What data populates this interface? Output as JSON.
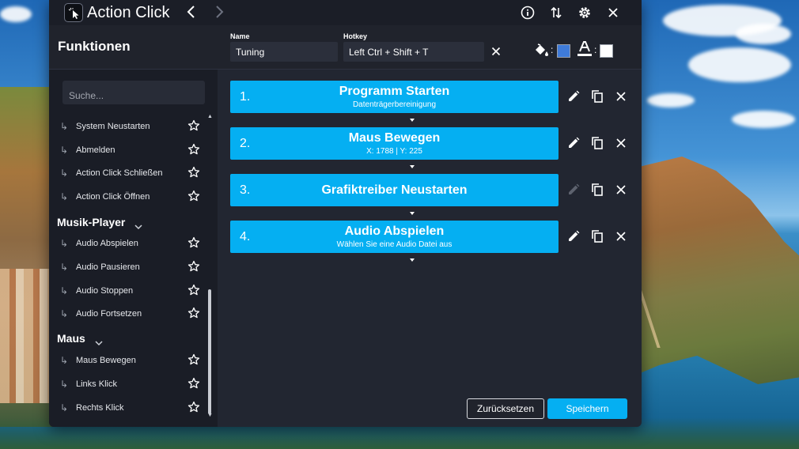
{
  "window": {
    "title": "Action Click",
    "icons": [
      "app-cursor-icon",
      "back-icon",
      "forward-icon",
      "info-icon",
      "sort-icon",
      "gear-icon",
      "close-icon"
    ]
  },
  "sidebar": {
    "title": "Funktionen",
    "search_placeholder": "Suche...",
    "items": [
      {
        "label": "System Neustarten"
      },
      {
        "label": "Abmelden"
      },
      {
        "label": "Action Click Schließen"
      },
      {
        "label": "Action Click Öffnen"
      }
    ],
    "categories": [
      {
        "label": "Musik-Player",
        "items": [
          {
            "label": "Audio Abspielen"
          },
          {
            "label": "Audio Pausieren"
          },
          {
            "label": "Audio Stoppen"
          },
          {
            "label": "Audio Fortsetzen"
          }
        ]
      },
      {
        "label": "Maus",
        "items": [
          {
            "label": "Maus Bewegen"
          },
          {
            "label": "Links Klick"
          },
          {
            "label": "Rechts Klick"
          }
        ]
      }
    ]
  },
  "form": {
    "name_label": "Name",
    "name_value": "Tuning",
    "hotkey_label": "Hotkey",
    "hotkey_value": "Left Ctrl + Shift + T",
    "colon": ":",
    "background_color": "#3f7bd9",
    "text_color": "#ffffff"
  },
  "steps": [
    {
      "num": "1.",
      "title": "Programm Starten",
      "subtitle": "Datenträgerbereinigung",
      "edit_enabled": true
    },
    {
      "num": "2.",
      "title": "Maus Bewegen",
      "subtitle": "X: 1788 | Y: 225",
      "edit_enabled": true
    },
    {
      "num": "3.",
      "title": "Grafiktreiber Neustarten",
      "subtitle": "",
      "edit_enabled": false
    },
    {
      "num": "4.",
      "title": "Audio Abspielen",
      "subtitle": "Wählen Sie eine Audio Datei aus",
      "edit_enabled": true
    }
  ],
  "buttons": {
    "reset": "Zurücksetzen",
    "save": "Speichern"
  },
  "colors": {
    "accent": "#05aff2",
    "window_bg": "#222631",
    "sidebar_bg": "#1a1d26"
  }
}
